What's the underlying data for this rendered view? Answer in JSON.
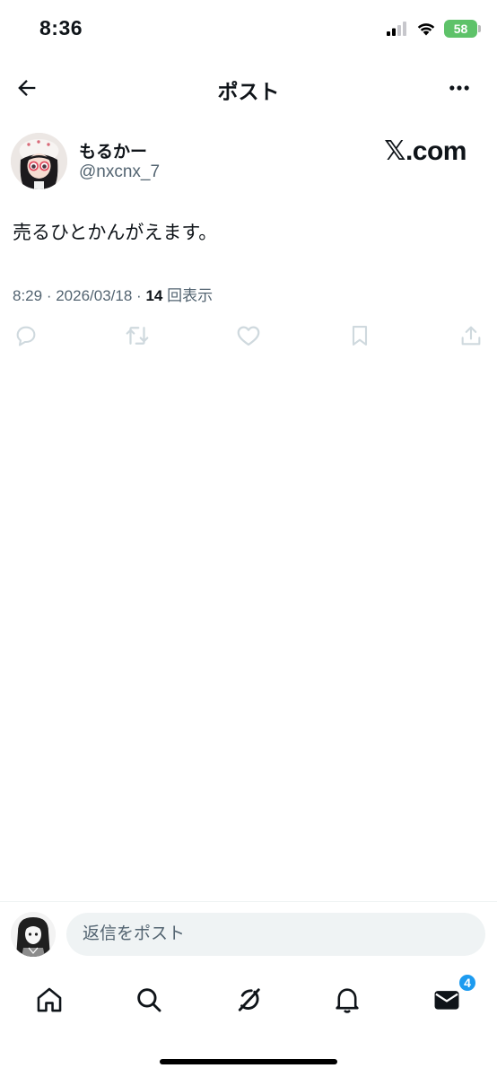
{
  "status_bar": {
    "time": "8:36",
    "battery": "58",
    "icons": [
      "cellular-signal-icon",
      "wifi-icon",
      "battery-charging-icon"
    ]
  },
  "header": {
    "title": "ポスト",
    "back_icon": "arrow-left-icon",
    "more_icon": "more-horizontal-icon"
  },
  "post": {
    "display_name": "もるかー",
    "handle": "@nxcnx_7",
    "watermark": "𝕏.com",
    "text": "売るひとかんがえます。",
    "time": "8:29",
    "date": "2026/03/18",
    "views_count": "14",
    "views_label": "回表示",
    "actions": [
      "reply-icon",
      "repost-icon",
      "like-icon",
      "bookmark-icon",
      "share-icon"
    ]
  },
  "reply": {
    "placeholder": "返信をポスト"
  },
  "tab_bar": {
    "tabs": [
      "home-icon",
      "search-icon",
      "grok-icon",
      "notifications-icon",
      "messages-icon"
    ],
    "messages_badge": "4"
  },
  "colors": {
    "text_primary": "#0f1419",
    "text_secondary": "#536471",
    "icon_muted": "#cfd9de",
    "accent": "#1d9bf0",
    "battery_green": "#5ec269",
    "input_background": "#eff3f4"
  }
}
